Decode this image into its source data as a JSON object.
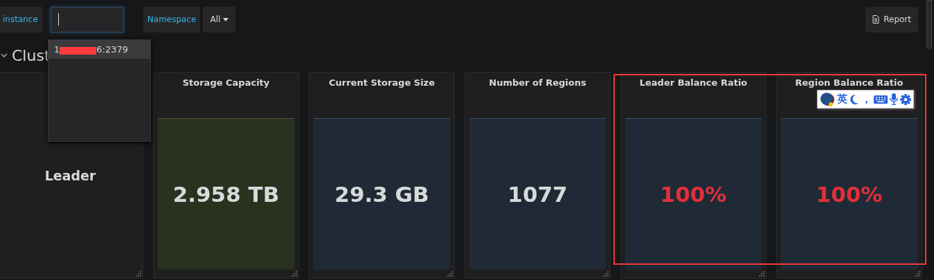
{
  "toolbar": {
    "variables": [
      {
        "label": "instance",
        "kind": "input",
        "focused": true
      },
      {
        "label": "Namespace",
        "kind": "select",
        "value": "All"
      }
    ],
    "report_button": "Report"
  },
  "instance_dropdown": {
    "items": [
      {
        "prefix": "1",
        "suffix": "6:2379",
        "redacted": true,
        "selected": true
      }
    ]
  },
  "row": {
    "title": "Clust",
    "expanded": true
  },
  "panels": [
    {
      "kind": "text",
      "text": "Leader"
    },
    {
      "kind": "stat",
      "title": "Storage Capacity",
      "value": "2.958 TB",
      "color": "#29311f",
      "alert": false
    },
    {
      "kind": "stat",
      "title": "Current Storage Size",
      "value": "29.3 GB",
      "color": "#1f2a36",
      "alert": false
    },
    {
      "kind": "stat",
      "title": "Number of Regions",
      "value": "1077",
      "color": "#1f2a36",
      "alert": false
    },
    {
      "kind": "stat",
      "title": "Leader Balance Ratio",
      "value": "100%",
      "color": "#1f2a36",
      "alert": true
    },
    {
      "kind": "stat",
      "title": "Region Balance Ratio",
      "value": "100%",
      "color": "#1f2a36",
      "alert": true
    }
  ],
  "ime_toolbar": {
    "language": "英",
    "punctuation": "，"
  }
}
